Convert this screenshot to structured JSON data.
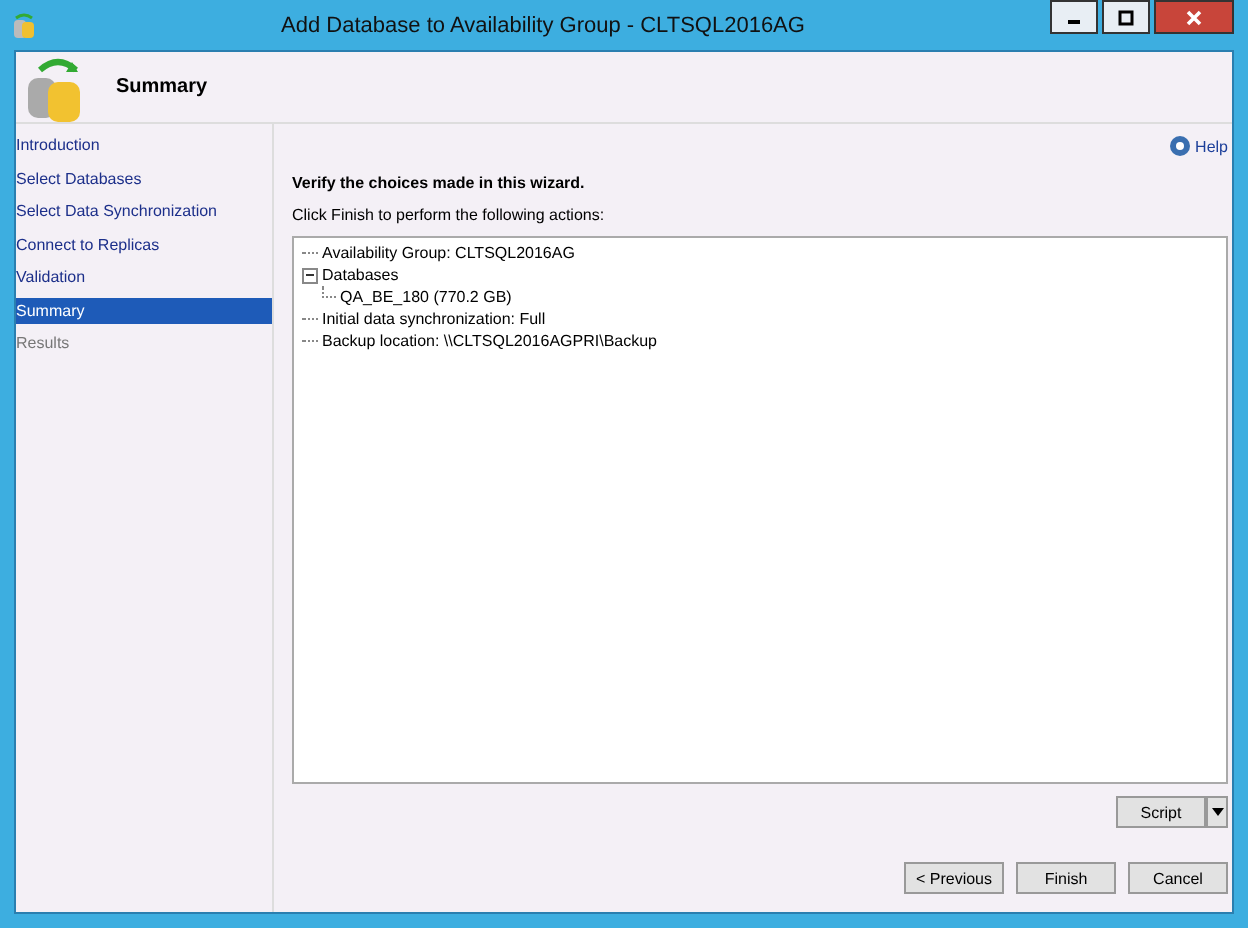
{
  "window": {
    "title": "Add Database to Availability Group - CLTSQL2016AG"
  },
  "header": {
    "title": "Summary"
  },
  "sidebar": {
    "items": [
      {
        "label": "Introduction",
        "selected": false,
        "disabled": false
      },
      {
        "label": "Select Databases",
        "selected": false,
        "disabled": false
      },
      {
        "label": "Select Data Synchronization",
        "selected": false,
        "disabled": false
      },
      {
        "label": "Connect to Replicas",
        "selected": false,
        "disabled": false
      },
      {
        "label": "Validation",
        "selected": false,
        "disabled": false
      },
      {
        "label": "Summary",
        "selected": true,
        "disabled": false
      },
      {
        "label": "Results",
        "selected": false,
        "disabled": true
      }
    ]
  },
  "help": {
    "label": "Help"
  },
  "content": {
    "heading": "Verify the choices made in this wizard.",
    "instruction": "Click Finish to perform the following actions:"
  },
  "tree": [
    {
      "label": "Availability Group: CLTSQL2016AG"
    },
    {
      "label": "Databases",
      "expanded": true,
      "children": [
        {
          "label": "QA_BE_180 (770.2 GB)"
        }
      ]
    },
    {
      "label": "Initial data synchronization: Full"
    },
    {
      "label": "Backup location: \\\\CLTSQL2016AGPRI\\Backup"
    }
  ],
  "script_button": {
    "label": "Script"
  },
  "buttons": [
    {
      "label": "< Previous"
    },
    {
      "label": "Finish"
    },
    {
      "label": "Cancel"
    }
  ]
}
